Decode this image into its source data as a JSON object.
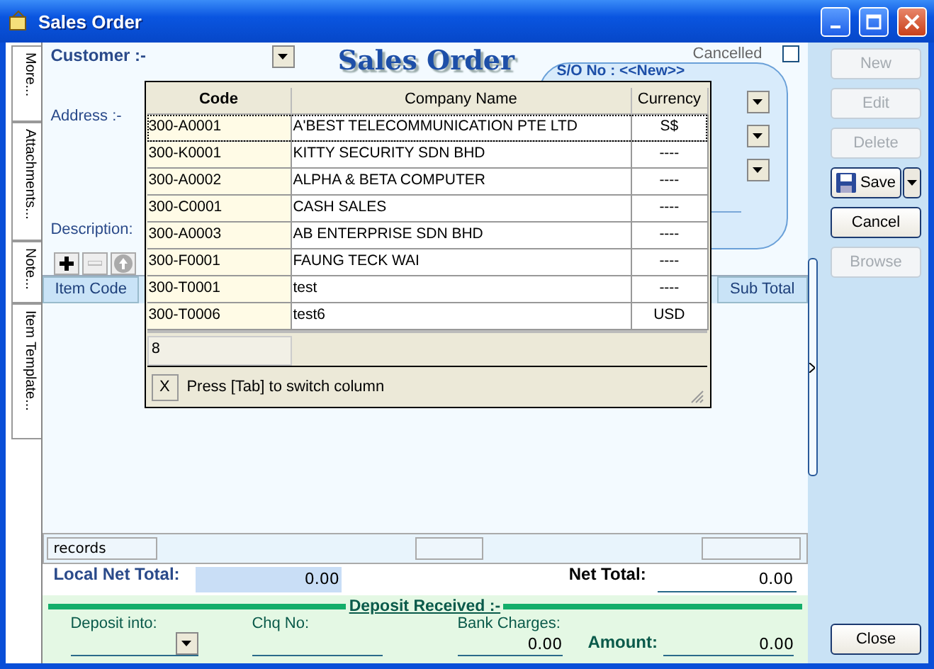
{
  "window": {
    "title": "Sales Order"
  },
  "side_tabs": [
    "More...",
    "Attachments...",
    "Note...",
    "Item Template..."
  ],
  "header": {
    "customer_label": "Customer :-",
    "address_label": "Address :-",
    "description_label": "Description:",
    "title": "Sales Order",
    "cancelled_label": "Cancelled",
    "cancelled": false,
    "so_no": "S/O No : <<New>>"
  },
  "grid": {
    "columns": [
      "Item Code",
      "Sub Total"
    ],
    "records_label": "records"
  },
  "lookup": {
    "columns": [
      "Code",
      "Company Name",
      "Currency"
    ],
    "rows": [
      {
        "code": "300-A0001",
        "company": "A'BEST TELECOMMUNICATION PTE LTD",
        "currency": "S$",
        "selected": true
      },
      {
        "code": "300-K0001",
        "company": "KITTY SECURITY SDN BHD",
        "currency": "----",
        "selected": false
      },
      {
        "code": "300-A0002",
        "company": "ALPHA & BETA COMPUTER",
        "currency": "----",
        "selected": false
      },
      {
        "code": "300-C0001",
        "company": "CASH SALES",
        "currency": "----",
        "selected": false
      },
      {
        "code": "300-A0003",
        "company": "AB ENTERPRISE SDN BHD",
        "currency": "----",
        "selected": false
      },
      {
        "code": "300-F0001",
        "company": "FAUNG TECK WAI",
        "currency": "----",
        "selected": false
      },
      {
        "code": "300-T0001",
        "company": "test",
        "currency": "----",
        "selected": false
      },
      {
        "code": "300-T0006",
        "company": "test6",
        "currency": "USD",
        "selected": false
      }
    ],
    "count": "8",
    "close": "X",
    "hint": "Press [Tab] to switch column"
  },
  "totals": {
    "local_net_total_label": "Local Net Total:",
    "local_net_total": "0.00",
    "net_total_label": "Net Total:",
    "net_total": "0.00"
  },
  "deposit": {
    "title": "Deposit Received :-",
    "deposit_into_label": "Deposit into:",
    "chq_no_label": "Chq No:",
    "bank_charges_label": "Bank Charges:",
    "bank_charges": "0.00",
    "amount_label": "Amount:",
    "amount": "0.00"
  },
  "buttons": [
    {
      "label": "New",
      "disabled": true,
      "kind": "plain"
    },
    {
      "label": "Edit",
      "disabled": true,
      "kind": "plain"
    },
    {
      "label": "Delete",
      "disabled": true,
      "kind": "plain"
    },
    {
      "label": "Save",
      "disabled": false,
      "kind": "split"
    },
    {
      "label": "Cancel",
      "disabled": false,
      "kind": "plain"
    },
    {
      "label": "Browse",
      "disabled": true,
      "kind": "plain"
    }
  ],
  "close_button": "Close"
}
